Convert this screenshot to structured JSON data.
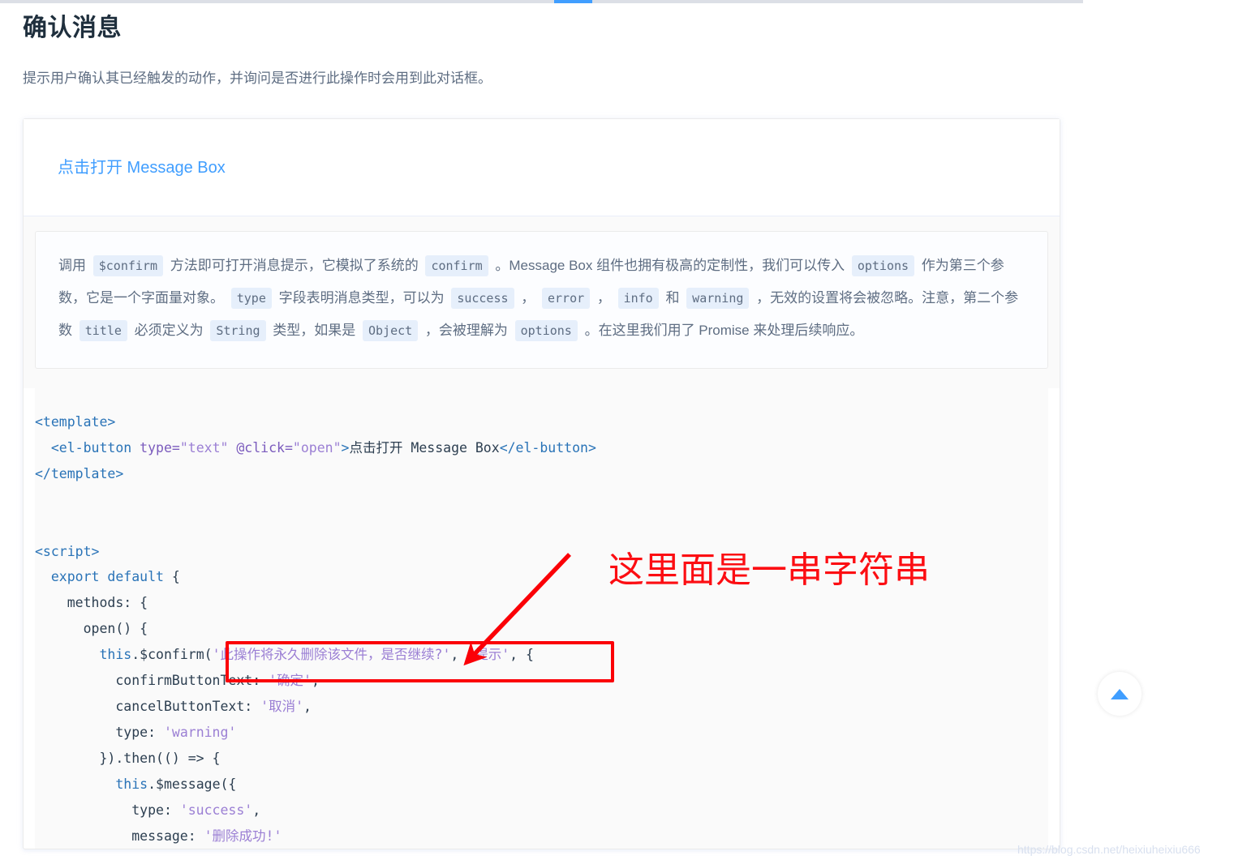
{
  "tabbar": {
    "active_tab_label": ""
  },
  "page": {
    "title": "确认消息",
    "description": "提示用户确认其已经触发的动作，并询问是否进行此操作时会用到此对话框。"
  },
  "demo": {
    "link_label": "点击打开 Message Box"
  },
  "demo_description": {
    "segments": [
      {
        "type": "text",
        "value": "调用 "
      },
      {
        "type": "code",
        "value": "$confirm"
      },
      {
        "type": "text",
        "value": " 方法即可打开消息提示，它模拟了系统的 "
      },
      {
        "type": "code",
        "value": "confirm"
      },
      {
        "type": "text",
        "value": " 。Message Box 组件也拥有极高的定制性，我们可以传入 "
      },
      {
        "type": "code",
        "value": "options"
      },
      {
        "type": "text",
        "value": " 作为第三个参数，它是一个字面量对象。 "
      },
      {
        "type": "code",
        "value": "type"
      },
      {
        "type": "text",
        "value": " 字段表明消息类型，可以为 "
      },
      {
        "type": "code",
        "value": "success"
      },
      {
        "type": "text",
        "value": " ， "
      },
      {
        "type": "code",
        "value": "error"
      },
      {
        "type": "text",
        "value": " ， "
      },
      {
        "type": "code",
        "value": "info"
      },
      {
        "type": "text",
        "value": " 和 "
      },
      {
        "type": "code",
        "value": "warning"
      },
      {
        "type": "text",
        "value": " ，无效的设置将会被忽略。注意，第二个参数 "
      },
      {
        "type": "code",
        "value": "title"
      },
      {
        "type": "text",
        "value": " 必须定义为 "
      },
      {
        "type": "code",
        "value": "String"
      },
      {
        "type": "text",
        "value": " 类型，如果是 "
      },
      {
        "type": "code",
        "value": "Object"
      },
      {
        "type": "text",
        "value": " ，会被理解为 "
      },
      {
        "type": "code",
        "value": "options"
      },
      {
        "type": "text",
        "value": " 。在这里我们用了 Promise 来处理后续响应。"
      }
    ]
  },
  "code": {
    "lines": [
      [
        {
          "t": "tag",
          "v": "<template>"
        }
      ],
      [
        {
          "t": "plain",
          "v": "  "
        },
        {
          "t": "tag",
          "v": "<el-button "
        },
        {
          "t": "attr",
          "v": "type="
        },
        {
          "t": "str",
          "v": "\"text\""
        },
        {
          "t": "plain",
          "v": " "
        },
        {
          "t": "attr",
          "v": "@click="
        },
        {
          "t": "str",
          "v": "\"open\""
        },
        {
          "t": "tag",
          "v": ">"
        },
        {
          "t": "cn",
          "v": "点击打开 Message Box"
        },
        {
          "t": "tag",
          "v": "</el-button>"
        }
      ],
      [
        {
          "t": "tag",
          "v": "</template>"
        }
      ],
      [
        {
          "t": "plain",
          "v": ""
        }
      ],
      [
        {
          "t": "plain",
          "v": ""
        }
      ],
      [
        {
          "t": "tag",
          "v": "<script>"
        }
      ],
      [
        {
          "t": "plain",
          "v": "  "
        },
        {
          "t": "kw",
          "v": "export default"
        },
        {
          "t": "plain",
          "v": " {"
        }
      ],
      [
        {
          "t": "plain",
          "v": "    methods: {"
        }
      ],
      [
        {
          "t": "plain",
          "v": "      open() {"
        }
      ],
      [
        {
          "t": "plain",
          "v": "        "
        },
        {
          "t": "kw",
          "v": "this"
        },
        {
          "t": "plain",
          "v": ".$confirm("
        },
        {
          "t": "str",
          "v": "'此操作将永久删除该文件，是否继续?'"
        },
        {
          "t": "plain",
          "v": ", "
        },
        {
          "t": "str",
          "v": "'提示'"
        },
        {
          "t": "plain",
          "v": ", {"
        }
      ],
      [
        {
          "t": "plain",
          "v": "          confirmButtonText: "
        },
        {
          "t": "str",
          "v": "'确定'"
        },
        {
          "t": "plain",
          "v": ","
        }
      ],
      [
        {
          "t": "plain",
          "v": "          cancelButtonText: "
        },
        {
          "t": "str",
          "v": "'取消'"
        },
        {
          "t": "plain",
          "v": ","
        }
      ],
      [
        {
          "t": "plain",
          "v": "          type: "
        },
        {
          "t": "str",
          "v": "'warning'"
        }
      ],
      [
        {
          "t": "plain",
          "v": "        }).then(() => {"
        }
      ],
      [
        {
          "t": "plain",
          "v": "          "
        },
        {
          "t": "kw",
          "v": "this"
        },
        {
          "t": "plain",
          "v": ".$message({"
        }
      ],
      [
        {
          "t": "plain",
          "v": "            type: "
        },
        {
          "t": "str",
          "v": "'success'"
        },
        {
          "t": "plain",
          "v": ","
        }
      ],
      [
        {
          "t": "plain",
          "v": "            message: "
        },
        {
          "t": "str",
          "v": "'删除成功!'"
        }
      ]
    ]
  },
  "annotation": {
    "text": "这里面是一串字符串",
    "color": "#fc0d12"
  },
  "backtop": {
    "icon": "caret-up-icon"
  },
  "watermark": {
    "text": "https://blog.csdn.net/heixiuheixiu666"
  },
  "colors": {
    "accent": "#409eff",
    "title": "#1f2f3d",
    "body_text": "#5e6d82",
    "annotation_red": "#fb0007",
    "inline_code_bg": "#e6effb"
  }
}
